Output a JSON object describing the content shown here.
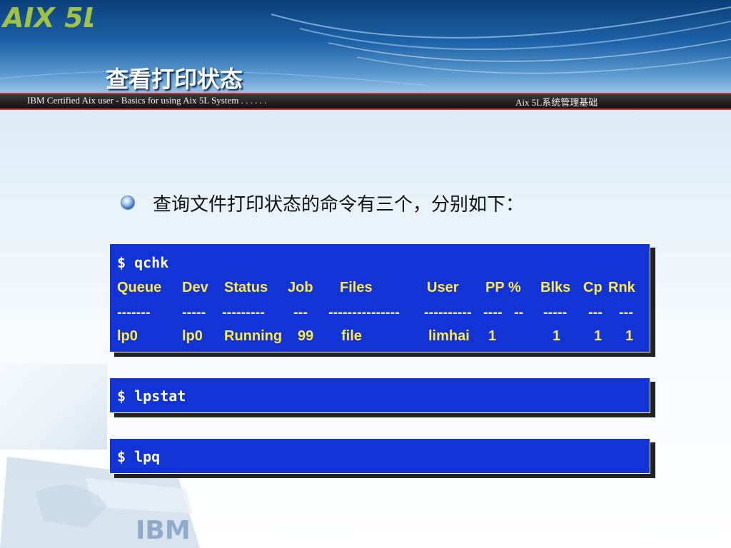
{
  "header": {
    "title": "查看打印状态",
    "logo_text": "AIX 5L",
    "subtitle_left": "IBM Certified Aix user - Basics for using Aix 5L System . . . . . .",
    "subtitle_right": "Aix 5L系统管理基础"
  },
  "bullet": {
    "text": "查询文件打印状态的命令有三个，分别如下："
  },
  "qchk_box": {
    "command": "$ qchk",
    "headers": [
      "Queue",
      "Dev",
      "Status",
      "Job",
      "Files",
      "User",
      "PP %",
      "Blks",
      "Cp",
      "Rnk"
    ],
    "separators": [
      "-------",
      "-----",
      "---------",
      "---",
      "---------------",
      "----------",
      "----",
      "--",
      "-----",
      "---",
      "---"
    ],
    "row": [
      "lp0",
      "lp0",
      "Running",
      "99",
      "file",
      "limhai",
      "1",
      "1",
      "1",
      "1"
    ]
  },
  "lpstat_box": {
    "command": "$ lpstat"
  },
  "lpq_box": {
    "command": "$ lpq"
  },
  "decor": {
    "watermark_text": "IBM"
  },
  "colors": {
    "box_bg": "#1233d6",
    "table_text": "#ffe94a",
    "command_text": "#ffffff"
  }
}
